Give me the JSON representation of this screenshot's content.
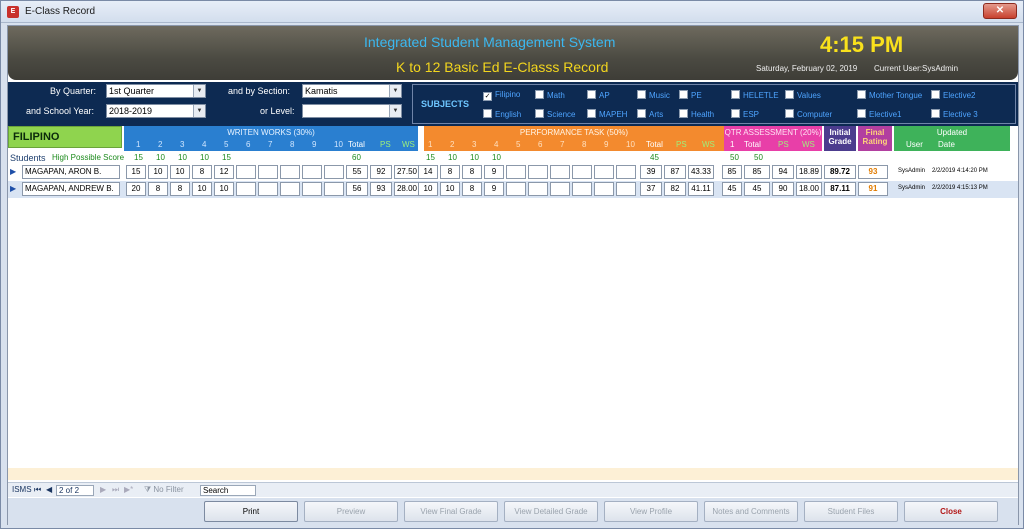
{
  "window": {
    "title": "E-Class Record",
    "icon": "app-icon",
    "close_icon": "close-x-icon"
  },
  "banner": {
    "title": "Integrated Student Management System",
    "subtitle": "K to 12 Basic Ed E-Classs Record",
    "time": "4:15 PM",
    "date": "Saturday, February 02, 2019",
    "current_user": "Current User:SysAdmin"
  },
  "filters": {
    "quarter_label": "By Quarter:",
    "quarter_value": "1st Quarter",
    "section_label": "and by Section:",
    "section_value": "Kamatis",
    "school_year_label": "and School Year:",
    "school_year_value": "2018-2019",
    "level_label": "or Level:",
    "level_value": "",
    "subjects_label": "SUBJECTS",
    "subjects": [
      {
        "name": "Filipino",
        "checked": true
      },
      {
        "name": "Math",
        "checked": false
      },
      {
        "name": "AP",
        "checked": false
      },
      {
        "name": "Music",
        "checked": false
      },
      {
        "name": "PE",
        "checked": false
      },
      {
        "name": "HELETLE",
        "checked": false
      },
      {
        "name": "Values",
        "checked": false
      },
      {
        "name": "Mother Tongue",
        "checked": false
      },
      {
        "name": "Elective2",
        "checked": false
      },
      {
        "name": "English",
        "checked": false
      },
      {
        "name": "Science",
        "checked": false
      },
      {
        "name": "MAPEH",
        "checked": false
      },
      {
        "name": "Arts",
        "checked": false
      },
      {
        "name": "Health",
        "checked": false
      },
      {
        "name": "ESP",
        "checked": false
      },
      {
        "name": "Computer",
        "checked": false
      },
      {
        "name": "Elective1",
        "checked": false
      },
      {
        "name": "Elective 3",
        "checked": false
      }
    ]
  },
  "grid": {
    "subject": "FILIPINO",
    "written_title": "WRITEN WORKS (30%)",
    "performance_title": "PERFORMANCE TASK (50%)",
    "qtr_title": "QTR ASSESSMENT (20%)",
    "initial_grade": "Initial Grade",
    "final_rating": "Final Rating",
    "updated": "Updated",
    "col_nums": [
      "1",
      "2",
      "3",
      "4",
      "5",
      "6",
      "7",
      "8",
      "9",
      "10"
    ],
    "total": "Total",
    "ps": "PS",
    "ws": "WS",
    "qtr_1": "1",
    "qtr_total": "Total",
    "user": "User",
    "date": "Date",
    "students_label": "Students",
    "hps_label": "High Possible Score",
    "hps_ww": [
      "15",
      "10",
      "10",
      "10",
      "15"
    ],
    "hps_ww_total": "60",
    "hps_pt": [
      "15",
      "10",
      "10",
      "10"
    ],
    "hps_pt_total": "45",
    "hps_qa": [
      "50",
      "50"
    ]
  },
  "rows": [
    {
      "name": "MAGAPAN, ARON B.",
      "ww": [
        "15",
        "10",
        "10",
        "8",
        "12",
        "",
        "",
        "",
        "",
        ""
      ],
      "ww_total": "55",
      "ww_ps": "92",
      "ww_ws": "27.50",
      "pt": [
        "14",
        "8",
        "8",
        "9",
        "",
        "",
        "",
        "",
        "",
        ""
      ],
      "pt_total": "39",
      "pt_ps": "87",
      "pt_ws": "43.33",
      "qa": "85",
      "qa_total": "85",
      "qa_ps": "94",
      "qa_ws": "18.89",
      "initial": "89.72",
      "final": "93",
      "user": "SysAdmin",
      "date": "2/2/2019 4:14:20 PM"
    },
    {
      "name": "MAGAPAN, ANDREW B.",
      "ww": [
        "20",
        "8",
        "8",
        "10",
        "10",
        "",
        "",
        "",
        "",
        ""
      ],
      "ww_total": "56",
      "ww_ps": "93",
      "ww_ws": "28.00",
      "pt": [
        "10",
        "10",
        "8",
        "9",
        "",
        "",
        "",
        "",
        "",
        ""
      ],
      "pt_total": "37",
      "pt_ps": "82",
      "pt_ws": "41.11",
      "qa": "45",
      "qa_total": "45",
      "qa_ps": "90",
      "qa_ws": "18.00",
      "initial": "87.11",
      "final": "91",
      "user": "SysAdmin",
      "date": "2/2/2019 4:15:13 PM"
    }
  ],
  "navbar": {
    "label": "ISMS",
    "record": "2 of 2",
    "no_filter": "No Filter",
    "search": "Search"
  },
  "buttons": [
    "Print",
    "Preview",
    "View Final Grade",
    "View Detailed Grade",
    "View Profile",
    "Notes and Comments",
    "Student Files",
    "Close"
  ]
}
